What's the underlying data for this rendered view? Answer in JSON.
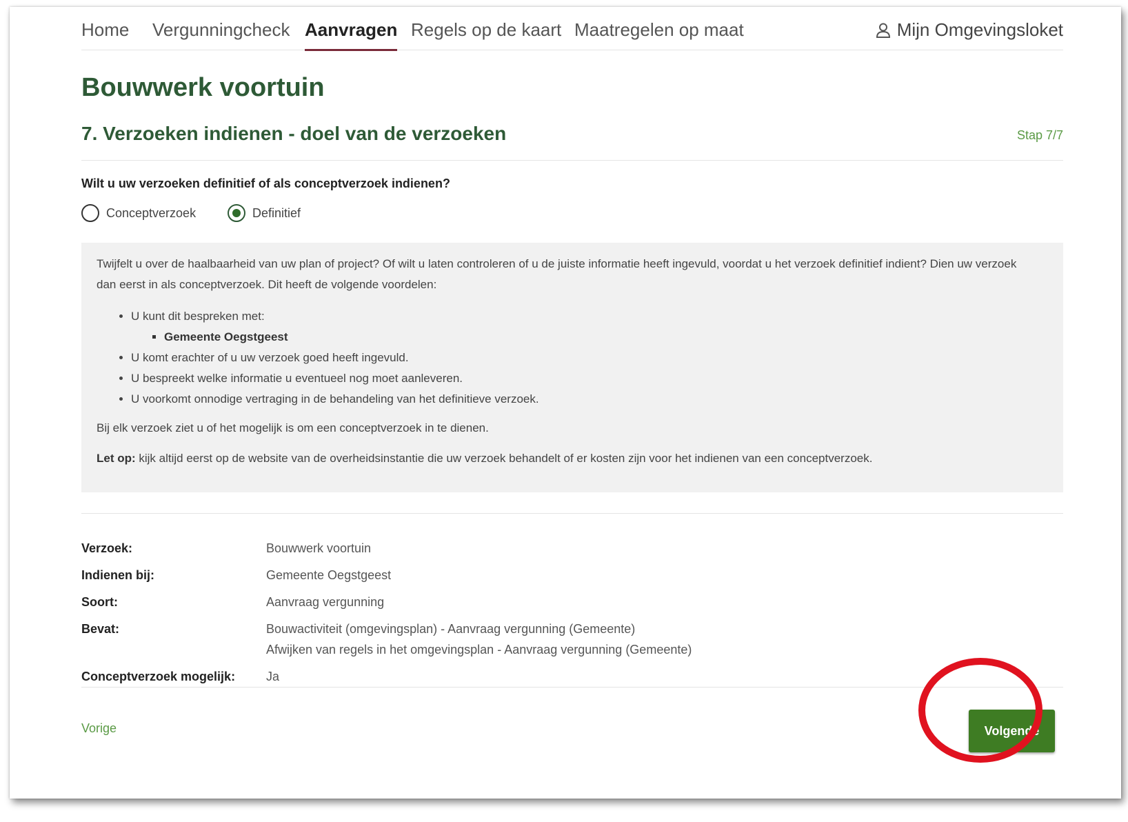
{
  "nav": {
    "items": [
      {
        "label": "Home",
        "active": false
      },
      {
        "label": "Vergunningcheck",
        "active": false
      },
      {
        "label": "Aanvragen",
        "active": true
      },
      {
        "label": "Regels op de kaart",
        "active": false
      },
      {
        "label": "Maatregelen op maat",
        "active": false
      }
    ],
    "user_label": "Mijn Omgevingsloket"
  },
  "page": {
    "title": "Bouwwerk voortuin",
    "step_title": "7. Verzoeken indienen - doel van de verzoeken",
    "step_count": "Stap 7/7"
  },
  "question": {
    "text": "Wilt u uw verzoeken definitief of als conceptverzoek indienen?",
    "options": [
      {
        "label": "Conceptverzoek",
        "checked": false
      },
      {
        "label": "Definitief",
        "checked": true
      }
    ]
  },
  "info": {
    "intro": "Twijfelt u over de haalbaarheid van uw plan of project? Of wilt u laten controleren of u de juiste informatie heeft ingevuld, voordat u het verzoek definitief indient? Dien uw verzoek dan eerst in als conceptverzoek. Dit heeft de volgende voordelen:",
    "bullet1": "U kunt dit bespreken met:",
    "bullet1_sub": "Gemeente Oegstgeest",
    "bullet2": "U komt erachter of u uw verzoek goed heeft ingevuld.",
    "bullet3": "U bespreekt welke informatie u eventueel nog moet aanleveren.",
    "bullet4": "U voorkomt onnodige vertraging in de behandeling van het definitieve verzoek.",
    "note": "Bij elk verzoek ziet u of het mogelijk is om een conceptverzoek in te dienen.",
    "warning_strong": "Let op:",
    "warning_text": " kijk altijd eerst op de website van de overheidsinstantie die uw verzoek behandelt of er kosten zijn voor het indienen van een conceptverzoek."
  },
  "summary": {
    "verzoek": {
      "label": "Verzoek:",
      "value": "Bouwwerk voortuin"
    },
    "indienen": {
      "label": "Indienen bij:",
      "value": "Gemeente Oegstgeest"
    },
    "soort": {
      "label": "Soort:",
      "value": "Aanvraag vergunning"
    },
    "bevat": {
      "label": "Bevat:",
      "value1": "Bouwactiviteit (omgevingsplan) - Aanvraag vergunning (Gemeente)",
      "value2": "Afwijken van regels in het omgevingsplan - Aanvraag vergunning (Gemeente)"
    },
    "concept": {
      "label": "Conceptverzoek mogelijk:",
      "value": "Ja"
    }
  },
  "footer": {
    "prev_label": "Vorige",
    "next_label": "Volgende"
  },
  "colors": {
    "heading_green": "#2e5a36",
    "link_green": "#5a9a45",
    "button_green": "#3e7c23",
    "nav_active_underline": "#7a2a3a",
    "highlight_red": "#e0121f",
    "info_background": "#f1f1f1"
  }
}
